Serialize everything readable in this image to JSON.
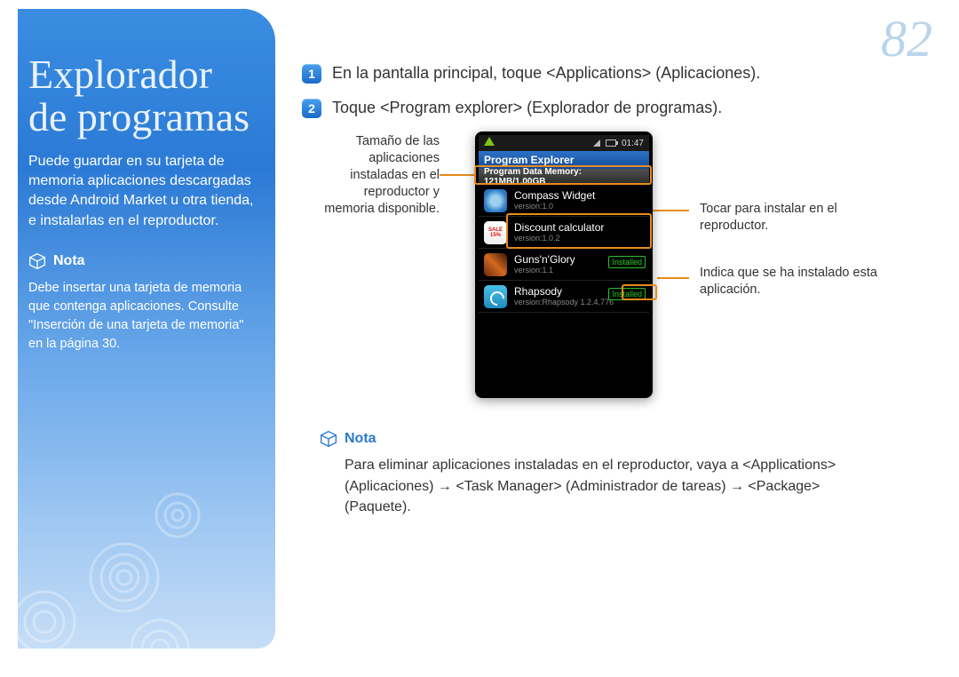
{
  "page_number": "82",
  "sidebar": {
    "title_line1": "Explorador",
    "title_line2": "de programas",
    "intro": "Puede guardar en su tarjeta de memoria aplicaciones descargadas desde Android Market u otra tienda, e instalarlas en el reproductor.",
    "nota_label": "Nota",
    "note": "Debe insertar una tarjeta de memoria que contenga aplicaciones. Consulte \"Inserción de una tarjeta de memoria\" en la página 30."
  },
  "steps": [
    {
      "n": "1",
      "text": "En la pantalla principal, toque <Applications> (Aplicaciones)."
    },
    {
      "n": "2",
      "text": "Toque <Program explorer> (Explorador de programas)."
    }
  ],
  "callouts": {
    "left": "Tamaño de las aplicaciones instaladas en el reproductor y memoria disponible.",
    "right1": "Tocar para instalar en el reproductor.",
    "right2": "Indica que se ha instalado esta aplicación."
  },
  "phone": {
    "clock": "01:47",
    "title": "Program Explorer",
    "memory": "Program Data Memory: 121MB/1.00GB",
    "apps": [
      {
        "name": "Compass Widget",
        "ver": "version:1.0",
        "installed": false,
        "icon": "compass"
      },
      {
        "name": "Discount calculator",
        "ver": "version:1.0.2",
        "installed": false,
        "icon": "sale"
      },
      {
        "name": "Guns'n'Glory",
        "ver": "version:1.1",
        "installed": true,
        "icon": "guns"
      },
      {
        "name": "Rhapsody",
        "ver": "version:Rhapsody 1.2.4.776",
        "installed": true,
        "icon": "rhap"
      }
    ],
    "installed_label": "Installed",
    "sale_text1": "SALE",
    "sale_text2": "15%"
  },
  "bottom_note": {
    "label": "Nota",
    "text": "Para eliminar aplicaciones instaladas en el reproductor, vaya a <Applications> (Aplicaciones) → <Task Manager> (Administrador de tareas) → <Package> (Paquete)."
  }
}
